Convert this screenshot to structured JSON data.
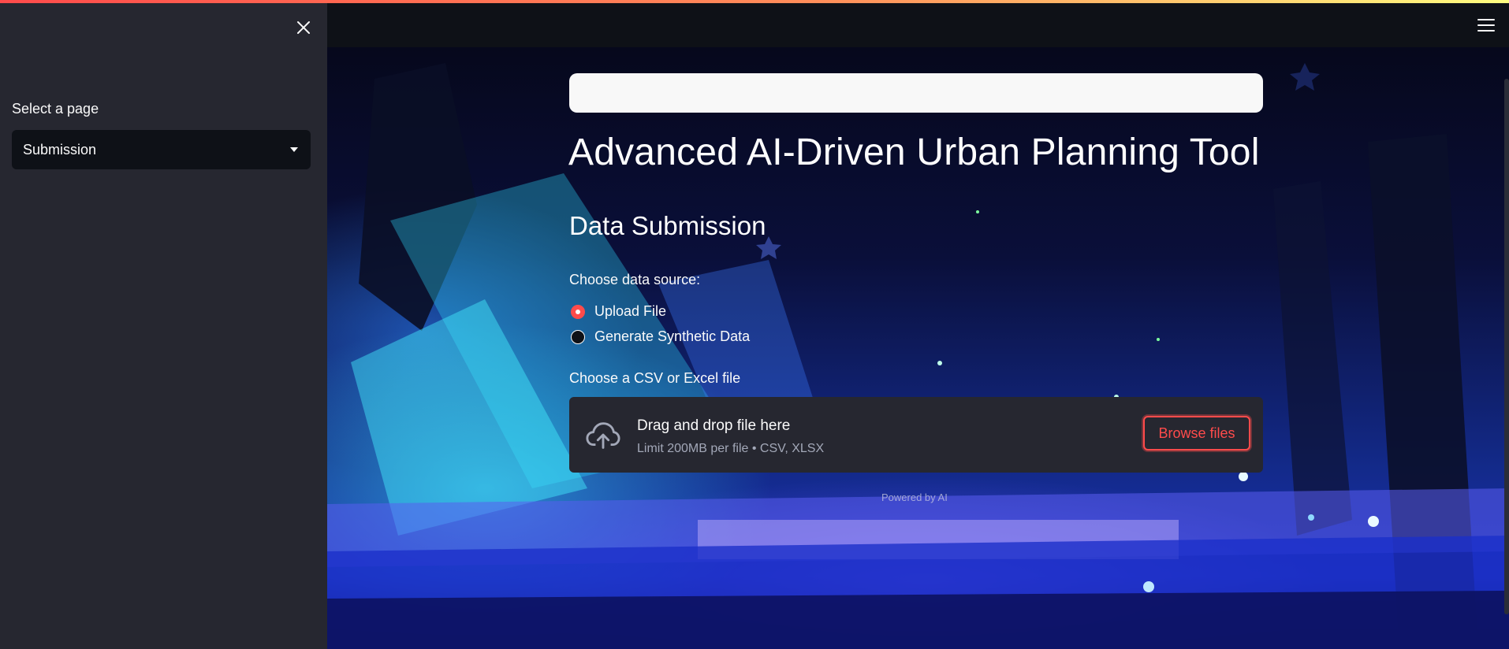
{
  "colors": {
    "accent": "#ff4b4b",
    "sidebar_bg": "#262730",
    "app_bg": "#0e1117"
  },
  "sidebar": {
    "close_icon": "close-icon",
    "select_label": "Select a page",
    "selected_page": "Submission"
  },
  "header": {
    "menu_icon": "hamburger-menu-icon"
  },
  "main": {
    "title": "Advanced AI-Driven Urban Planning Tool",
    "section_title": "Data Submission",
    "data_source": {
      "label": "Choose data source:",
      "options": [
        "Upload File",
        "Generate Synthetic Data"
      ],
      "selected": "Upload File"
    },
    "uploader": {
      "label": "Choose a CSV or Excel file",
      "icon": "cloud-upload-icon",
      "title": "Drag and drop file here",
      "subtitle": "Limit 200MB per file • CSV, XLSX",
      "button_label": "Browse files"
    },
    "footer": "Powered by AI"
  }
}
